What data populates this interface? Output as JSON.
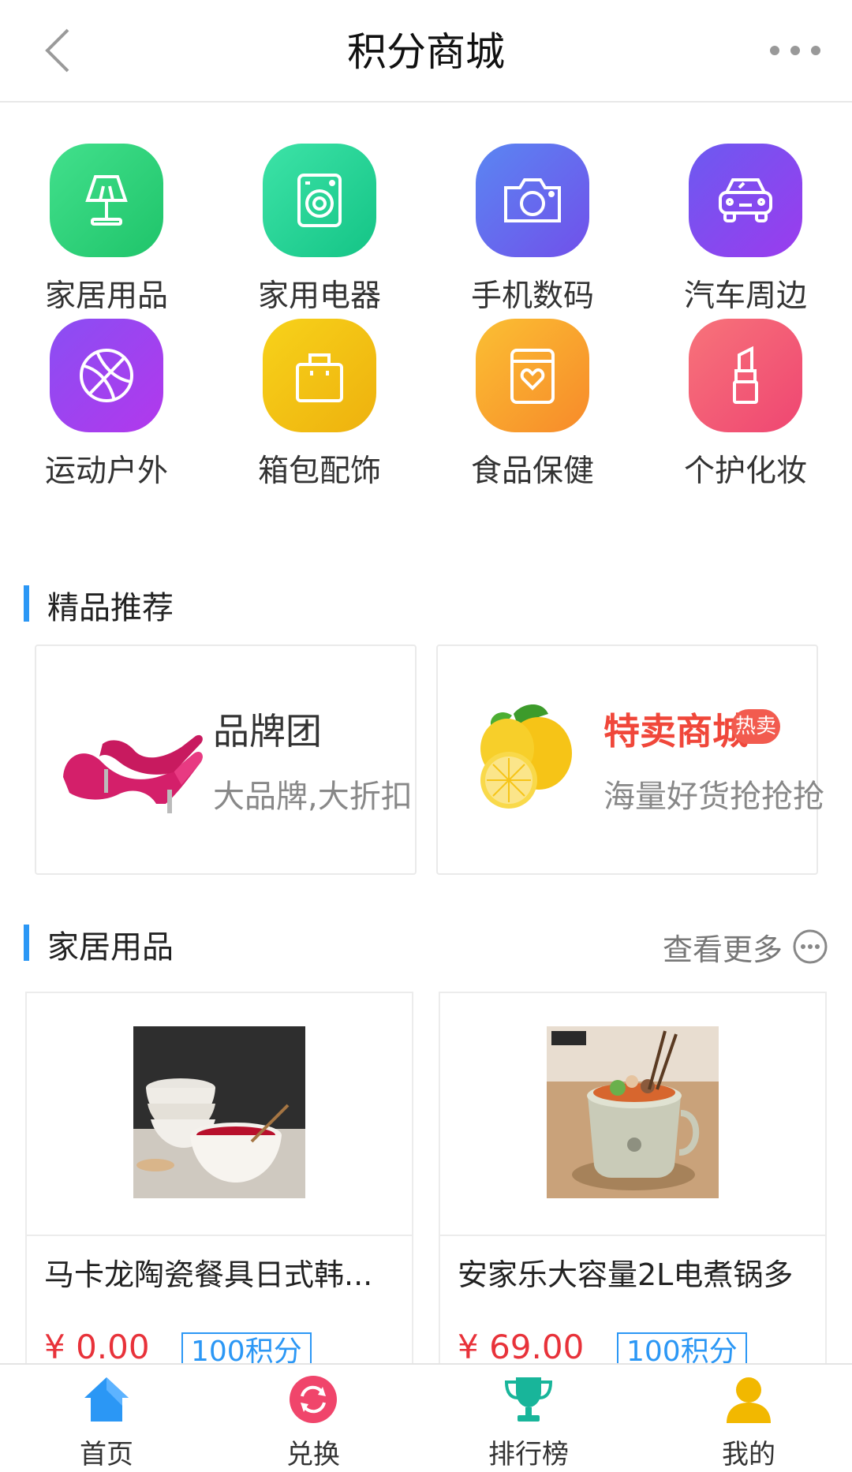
{
  "header": {
    "title": "积分商城"
  },
  "categories": [
    {
      "label": "家居用品",
      "icon": "lamp-icon",
      "color": "#2fd07c"
    },
    {
      "label": "家用电器",
      "icon": "washing-machine-icon",
      "color": "#26d29a"
    },
    {
      "label": "手机数码",
      "icon": "camera-icon",
      "color": "#6a5cf0"
    },
    {
      "label": "汽车周边",
      "icon": "car-icon",
      "color": "#8a45ee"
    },
    {
      "label": "运动户外",
      "icon": "basketball-icon",
      "color": "#9a3ef0"
    },
    {
      "label": "箱包配饰",
      "icon": "bag-icon",
      "color": "#f2c21a"
    },
    {
      "label": "食品保健",
      "icon": "food-jar-icon",
      "color": "#f8a02c"
    },
    {
      "label": "个护化妆",
      "icon": "lipstick-icon",
      "color": "#f25276"
    }
  ],
  "featured": {
    "title": "精品推荐",
    "items": [
      {
        "title": "品牌团",
        "subtitle": "大品牌,大折扣"
      },
      {
        "title": "特卖商城",
        "badge": "热卖",
        "subtitle": "海量好货抢抢抢"
      }
    ]
  },
  "home_section": {
    "title": "家居用品",
    "more_label": "查看更多",
    "products": [
      {
        "name": "马卡龙陶瓷餐具日式韩...",
        "price": "¥ 0.00",
        "points": "100积分"
      },
      {
        "name": "安家乐大容量2L电煮锅多",
        "price": "¥ 69.00",
        "points": "100积分"
      }
    ]
  },
  "tabbar": [
    {
      "label": "首页",
      "icon": "home-icon",
      "color": "#2b97f5"
    },
    {
      "label": "兑换",
      "icon": "exchange-icon",
      "color": "#f0456b"
    },
    {
      "label": "排行榜",
      "icon": "trophy-icon",
      "color": "#18b59a"
    },
    {
      "label": "我的",
      "icon": "user-icon",
      "color": "#f2b800"
    }
  ]
}
